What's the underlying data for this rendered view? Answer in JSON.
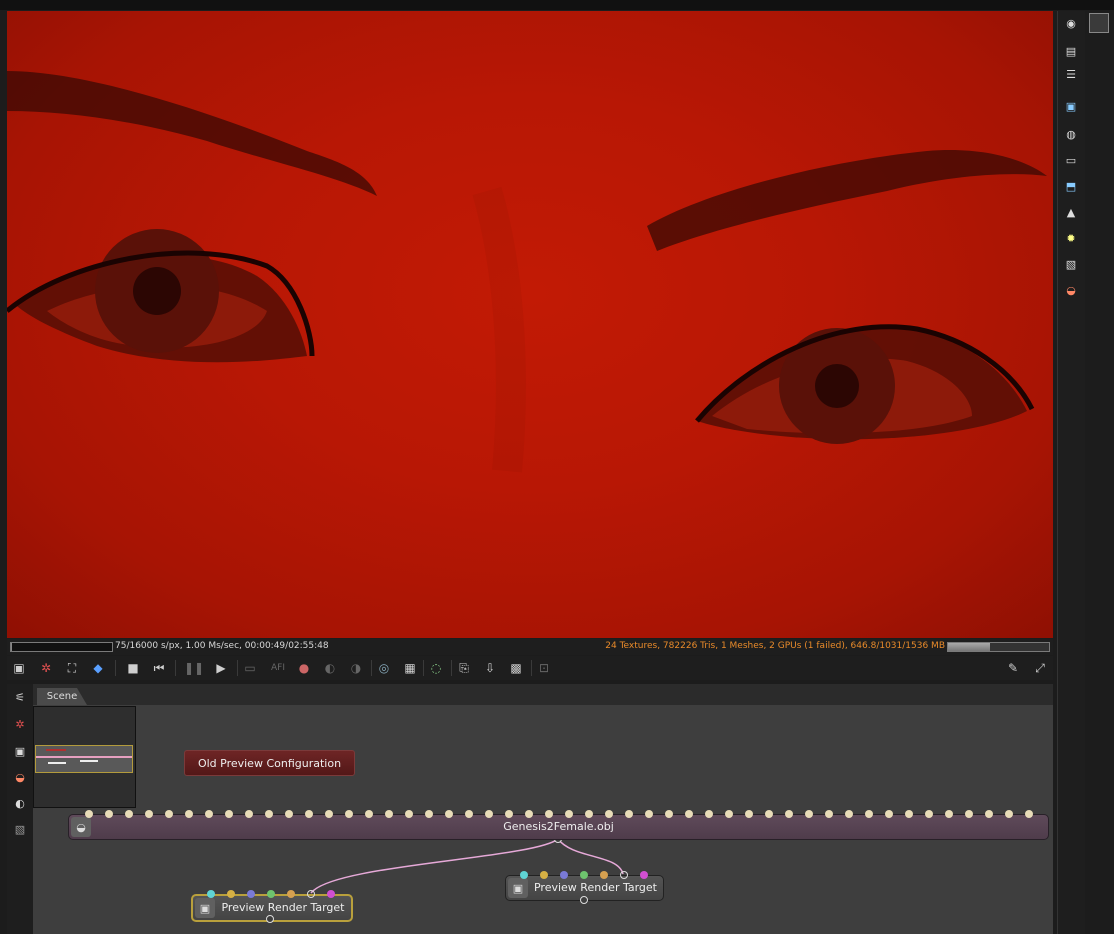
{
  "status": {
    "progress_fraction": 0.005,
    "render_stats": "75/16000 s/px, 1.00 Ms/sec, 00:00:49/02:55:48",
    "scene_stats": "24 Textures, 782226 Tris, 1 Meshes, 2 GPUs (1 failed), 646.8/1031/1536 MB",
    "memory_fraction": 0.42
  },
  "toolbar": {
    "afi_label": "AFI"
  },
  "graph": {
    "tab_scene": "Scene",
    "old_preview_button": "Old Preview Configuration",
    "mesh_node_title": "Genesis2Female.obj",
    "prt_node_1_title": "Preview Render Target",
    "prt_node_2_title": "Preview Render Target"
  },
  "colors": {
    "viewport_red": "#b81705",
    "status_warning": "#e88a2a",
    "selected_node_border": "#b9a03c",
    "link_pink": "#e6a9d8"
  },
  "icons": {
    "toolbar": [
      "screenshot-icon",
      "reset-camera-icon",
      "fit-icon",
      "color-cube-icon",
      "stop-icon",
      "restart-icon",
      "pause-icon",
      "play-icon",
      "display-icon",
      "afi-icon",
      "color-picker-icon",
      "tone-icon",
      "material-icon",
      "camera-pick-icon",
      "region-icon",
      "render-priority-icon",
      "copy-icon",
      "save-icon",
      "export-icon",
      "lock-icon",
      "wrench-icon",
      "fullscreen-icon"
    ],
    "right_sidebar": [
      "camera-icon",
      "layers-icon",
      "list-icon",
      "image-icon",
      "camera-settings-icon",
      "film-icon",
      "mesh-icon",
      "environment-icon",
      "light-icon",
      "texture-icon",
      "material-icon"
    ]
  }
}
